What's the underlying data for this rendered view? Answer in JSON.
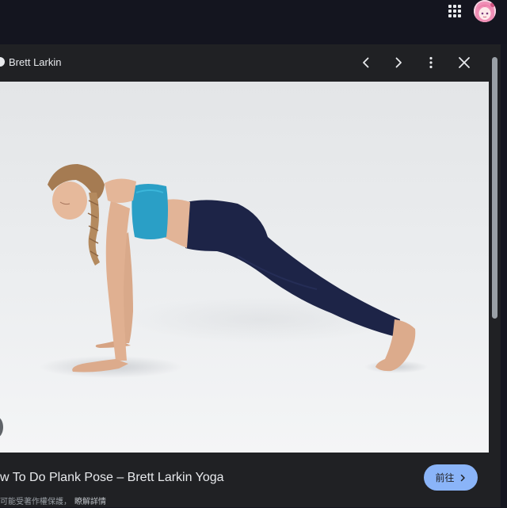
{
  "topbar": {
    "apps_icon": "apps-grid-icon",
    "avatar_icon": "user-avatar"
  },
  "viewer": {
    "source_name": "Brett Larkin",
    "icons": {
      "prev": "chevron-left-icon",
      "next": "chevron-right-icon",
      "more": "more-vert-icon",
      "close": "close-icon"
    },
    "image_title": "w To Do Plank Pose – Brett Larkin Yoga",
    "visit_label": "前往",
    "copyright_text": "可能受著作權保護，",
    "learn_more": "瞭解詳情",
    "colors": {
      "panel_bg": "#202124",
      "topbar_bg": "#14151f",
      "accent": "#8ab4f8",
      "bra": "#2a9fc6",
      "leggings": "#1d2447"
    }
  }
}
